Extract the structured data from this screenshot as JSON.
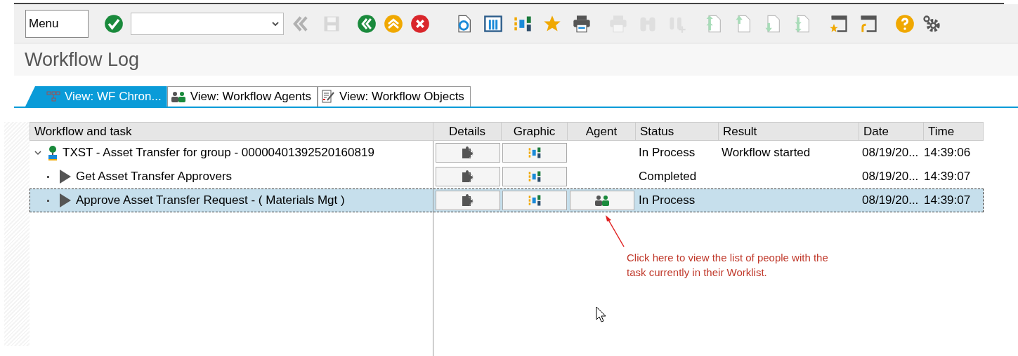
{
  "toolbar": {
    "menu_label": "Menu",
    "buttons": [
      {
        "disabled": false
      },
      {
        "disabled": true
      },
      {
        "disabled": true
      },
      {
        "disabled": false
      },
      {
        "disabled": false
      },
      {
        "disabled": false
      },
      {
        "disabled": false
      },
      {
        "disabled": false
      },
      {
        "disabled": false
      },
      {
        "disabled": false
      },
      {
        "disabled": false
      },
      {
        "disabled": true
      },
      {
        "disabled": true
      },
      {
        "disabled": true
      },
      {
        "disabled": false
      },
      {
        "disabled": false
      },
      {
        "disabled": false
      },
      {
        "disabled": false
      },
      {
        "disabled": false
      },
      {
        "disabled": false
      },
      {
        "disabled": false
      },
      {
        "disabled": false
      }
    ]
  },
  "title": "Workflow Log",
  "tabs": [
    {
      "label": "View: WF Chron...",
      "selected": true
    },
    {
      "label": "View: Workflow Agents",
      "selected": false
    },
    {
      "label": "View: Workflow Objects",
      "selected": false
    }
  ],
  "table": {
    "columns": [
      "Workflow and task",
      "Details",
      "Graphic",
      "Agent",
      "Status",
      "Result",
      "Date",
      "Time"
    ],
    "rows": [
      {
        "kind": "workflow",
        "title": "TXST - Asset Transfer for group - 00000401392520160819",
        "expanded": true,
        "selected": false,
        "agent_button": false,
        "status": "In Process",
        "result": "Workflow started",
        "date": "08/19/20...",
        "time": "14:39:06",
        "children": [
          {
            "kind": "task",
            "title": "Get Asset Transfer Approvers",
            "selected": false,
            "agent_button": false,
            "status": "Completed",
            "date": "08/19/20...",
            "time": "14:39:07"
          },
          {
            "kind": "task",
            "title": "Approve Asset Transfer Request - ( Materials Mgt )",
            "selected": true,
            "agent_button": true,
            "status": "In Process",
            "date": "08/19/20...",
            "time": "14:39:07"
          }
        ]
      }
    ]
  },
  "annotation": {
    "text": "Click here to view the list of people with the task currently in their Worklist."
  }
}
